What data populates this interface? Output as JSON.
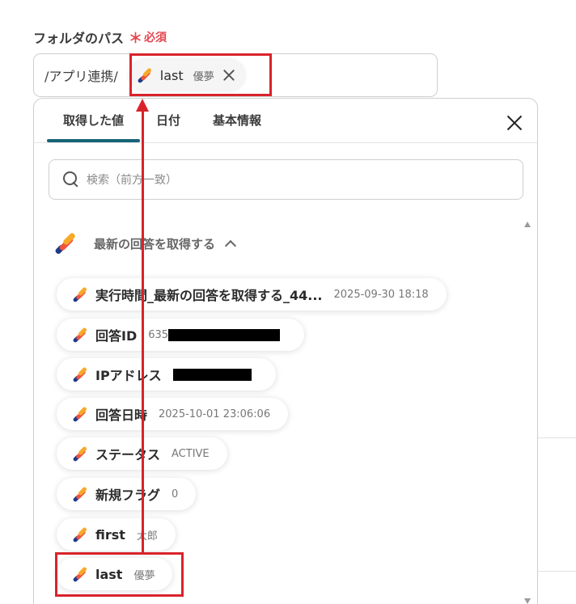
{
  "field": {
    "label": "フォルダのパス",
    "required_mark": "＊",
    "required_text": "必須",
    "path_prefix": "/アプリ連携/",
    "chip_label": "last",
    "chip_value": "優夢"
  },
  "dropdown": {
    "tabs": [
      {
        "label": "取得した値",
        "active": true
      },
      {
        "label": "日付",
        "active": false
      },
      {
        "label": "基本情報",
        "active": false
      }
    ],
    "search_placeholder": "検索（前方一致）",
    "section_title": "最新の回答を取得する",
    "items": [
      {
        "label": "実行時間_最新の回答を取得する_44...",
        "value": "2025-09-30 18:18"
      },
      {
        "label": "回答ID",
        "value": "635"
      },
      {
        "label": "IPアドレス",
        "value": ""
      },
      {
        "label": "回答日時",
        "value": "2025-10-01 23:06:06"
      },
      {
        "label": "ステータス",
        "value": "ACTIVE"
      },
      {
        "label": "新規フラグ",
        "value": "0"
      },
      {
        "label": "first",
        "value": "太郎"
      },
      {
        "label": "last",
        "value": "優夢"
      }
    ]
  },
  "colors": {
    "accent": "#176377",
    "required": "#e5464f",
    "annotation": "#d9232b"
  },
  "icons": [
    "app-logo-icon",
    "close-icon",
    "search-icon",
    "chevron-up-icon"
  ]
}
